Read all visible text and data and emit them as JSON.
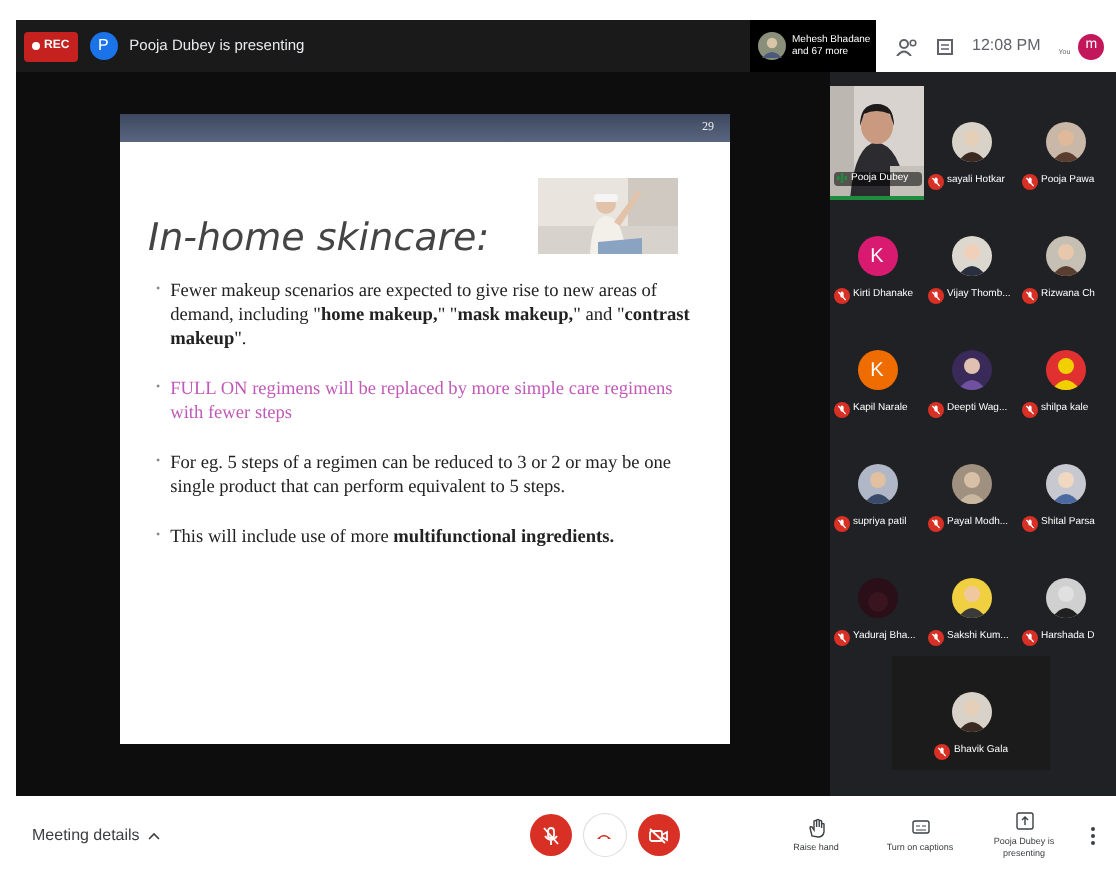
{
  "top_bar": {
    "rec_badge": "REC",
    "presenter_avatar": "P",
    "presenter_text": "Pooja Dubey is presenting",
    "participants_summary": {
      "name": "Mehesh Bhadane",
      "more": "and 67 more"
    },
    "time": "12:08 PM",
    "user_avatar": "m",
    "user_label": "You"
  },
  "slide": {
    "number": "29",
    "title": "In-home skincare:",
    "bullets": [
      {
        "bullet": "•",
        "text": "Fewer makeup scenarios are expected to give rise to new areas of demand, including \"**home makeup,**\" \"**mask makeup,**\" and \"**contrast makeup**\".",
        "highlighted": false
      },
      {
        "bullet": "•",
        "text": "FULL ON regimens will be replaced by more simple care regimens with fewer steps",
        "highlighted": true
      },
      {
        "bullet": "•",
        "text": "For eg. 5 steps of a regimen can be reduced to 3 or 2 or may be one single product that can perform equivalent to 5 steps.",
        "highlighted": false
      },
      {
        "bullet": "•",
        "text": "This will include use of more **multifunctional ingredients.**",
        "highlighted": false
      }
    ]
  },
  "participants": [
    {
      "name": "Pooja Dubey",
      "kind": "video",
      "speaking": true,
      "muted": false
    },
    {
      "name": "sayali Hotkar",
      "muted": true
    },
    {
      "name": "Pooja Pawa",
      "muted": true
    },
    {
      "name": "Kirti Dhanake",
      "kind": "letter",
      "letter": "K",
      "color": "#d81b70",
      "muted": true
    },
    {
      "name": "Vijay Thomb...",
      "muted": true
    },
    {
      "name": "Rizwana Ch",
      "muted": true
    },
    {
      "name": "Kapil Narale",
      "kind": "letter",
      "letter": "K",
      "color": "#ef6c00",
      "muted": true
    },
    {
      "name": "Deepti Wag...",
      "muted": true
    },
    {
      "name": "shilpa kale",
      "muted": true
    },
    {
      "name": "supriya patil",
      "muted": true
    },
    {
      "name": "Payal Modh...",
      "muted": true
    },
    {
      "name": "Shital Parsa",
      "muted": true
    },
    {
      "name": "Yaduraj Bha...",
      "kind": "blank",
      "muted": true
    },
    {
      "name": "Sakshi Kum...",
      "muted": true
    },
    {
      "name": "Harshada D",
      "muted": true
    },
    {
      "name": "Bhavik Gala",
      "muted": true
    }
  ],
  "bottom_bar": {
    "meeting_details": "Meeting details",
    "mic_on": false,
    "camera_on": false,
    "actions": [
      {
        "kind": "hand",
        "label": "Raise hand"
      },
      {
        "kind": "captions",
        "label": "Turn on captions"
      },
      {
        "kind": "present",
        "label": "Pooja Dubey is presenting"
      }
    ]
  }
}
